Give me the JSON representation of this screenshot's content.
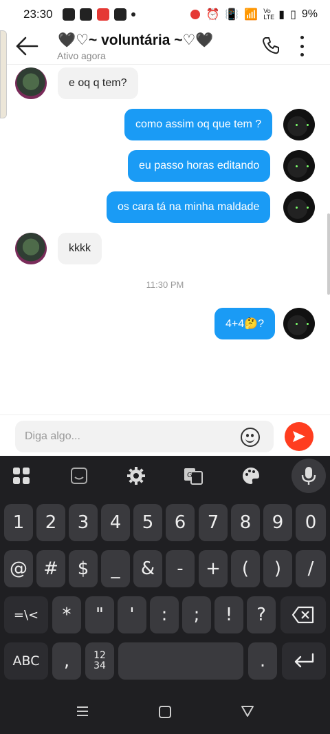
{
  "status_bar": {
    "time": "23:30",
    "battery": "9%",
    "signal_label": "Vo LTE"
  },
  "header": {
    "title": "🖤♡~ voluntária ~♡🖤",
    "subtitle": "Ativo agora"
  },
  "messages": [
    {
      "side": "in",
      "text": "e oq q tem?"
    },
    {
      "side": "out",
      "text": "como assim oq que tem ?"
    },
    {
      "side": "out",
      "text": "eu passo horas editando"
    },
    {
      "side": "out",
      "text": "os cara tá na minha maldade"
    },
    {
      "side": "in",
      "text": "kkkk"
    },
    {
      "side": "out",
      "text": "4+4🤔?"
    }
  ],
  "timestamp": "11:30 PM",
  "composer": {
    "placeholder": "Diga algo..."
  },
  "keyboard": {
    "toolbar": [
      "apps-icon",
      "sticker-icon",
      "settings-icon",
      "translate-icon",
      "palette-icon",
      "mic-icon"
    ],
    "row1": [
      "1",
      "2",
      "3",
      "4",
      "5",
      "6",
      "7",
      "8",
      "9",
      "0"
    ],
    "row2": [
      "@",
      "#",
      "$",
      "_",
      "&",
      "-",
      "+",
      "(",
      ")",
      "/"
    ],
    "row3": [
      "=\\<",
      "*",
      "\"",
      "'",
      ":",
      ";",
      "!",
      "?"
    ],
    "row4": {
      "abc": "ABC",
      "comma": ",",
      "numpad": "12\n34",
      "period": "."
    }
  }
}
